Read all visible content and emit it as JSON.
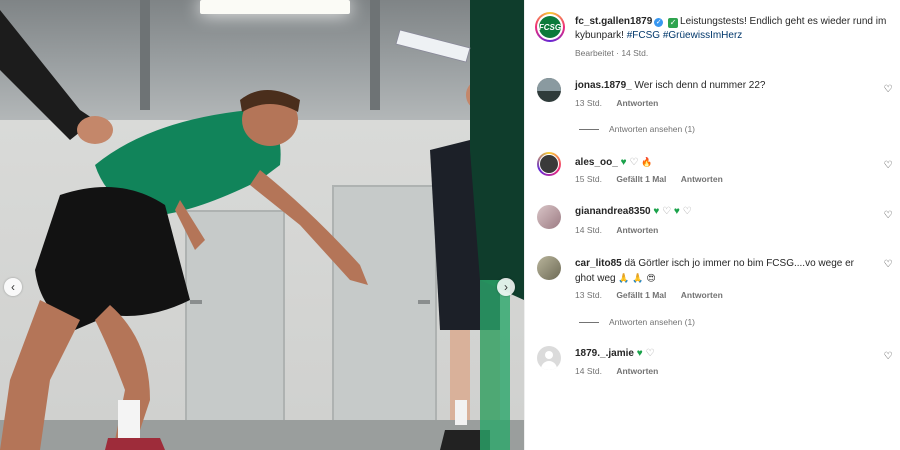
{
  "carousel": {
    "prev_glyph": "‹",
    "next_glyph": "›"
  },
  "post": {
    "username": "fc_st.gallen1879",
    "logo_text": "FCSG",
    "verified_glyph": "✓",
    "check_glyph": "✓",
    "caption_text": "Leistungstests! Endlich geht es wieder rund im kybunpark!",
    "hashtag1": "#FCSG",
    "hashtag2": "#GrüewissImHerz",
    "edited": "Bearbeitet",
    "age": "14 Std."
  },
  "icons": {
    "heart": "♡",
    "green_heart": "♥",
    "white_heart": "♡",
    "fire": "🔥",
    "pray": "🙏",
    "heart_eyes": "😍"
  },
  "comments": [
    {
      "username": "jonas.1879_",
      "text": "Wer isch denn d nummer 22?",
      "age": "13 Std.",
      "likes": "",
      "reply": "Antworten",
      "view_replies": "Antworten ansehen (1)"
    },
    {
      "username": "ales_oo_",
      "text": "",
      "age": "15 Std.",
      "likes": "Gefällt 1 Mal",
      "reply": "Antworten"
    },
    {
      "username": "gianandrea8350",
      "text": "",
      "age": "14 Std.",
      "likes": "",
      "reply": "Antworten"
    },
    {
      "username": "car_lito85",
      "text": "dä Görtler isch jo immer no bim FCSG....vo wege er ghot weg",
      "age": "13 Std.",
      "likes": "Gefällt 1 Mal",
      "reply": "Antworten",
      "view_replies": "Antworten ansehen (1)"
    },
    {
      "username": "1879._.jamie",
      "text": "",
      "age": "14 Std.",
      "likes": "",
      "reply": "Antworten"
    }
  ]
}
